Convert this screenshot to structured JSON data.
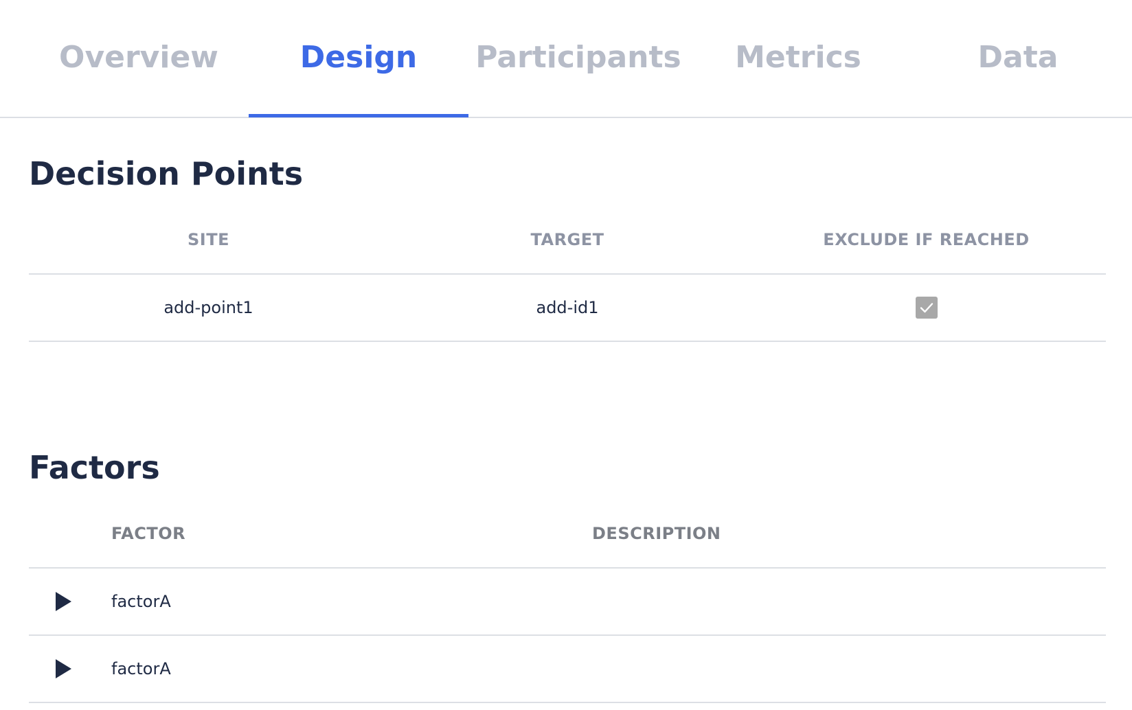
{
  "tabs": [
    {
      "label": "Overview",
      "active": false
    },
    {
      "label": "Design",
      "active": true
    },
    {
      "label": "Participants",
      "active": false
    },
    {
      "label": "Metrics",
      "active": false
    },
    {
      "label": "Data",
      "active": false
    }
  ],
  "accent_color": "#3d6ae6",
  "decision_points": {
    "title": "Decision Points",
    "columns": {
      "site": "SITE",
      "target": "TARGET",
      "exclude": "EXCLUDE IF REACHED"
    },
    "rows": [
      {
        "site": "add-point1",
        "target": "add-id1",
        "exclude_if_reached": true
      }
    ]
  },
  "factors": {
    "title": "Factors",
    "columns": {
      "factor": "FACTOR",
      "description": "DESCRIPTION"
    },
    "rows": [
      {
        "factor": "factorA",
        "description": "",
        "expand_icon": "triangle-right-icon"
      },
      {
        "factor": "factorA",
        "description": "",
        "expand_icon": "triangle-right-icon"
      }
    ]
  }
}
